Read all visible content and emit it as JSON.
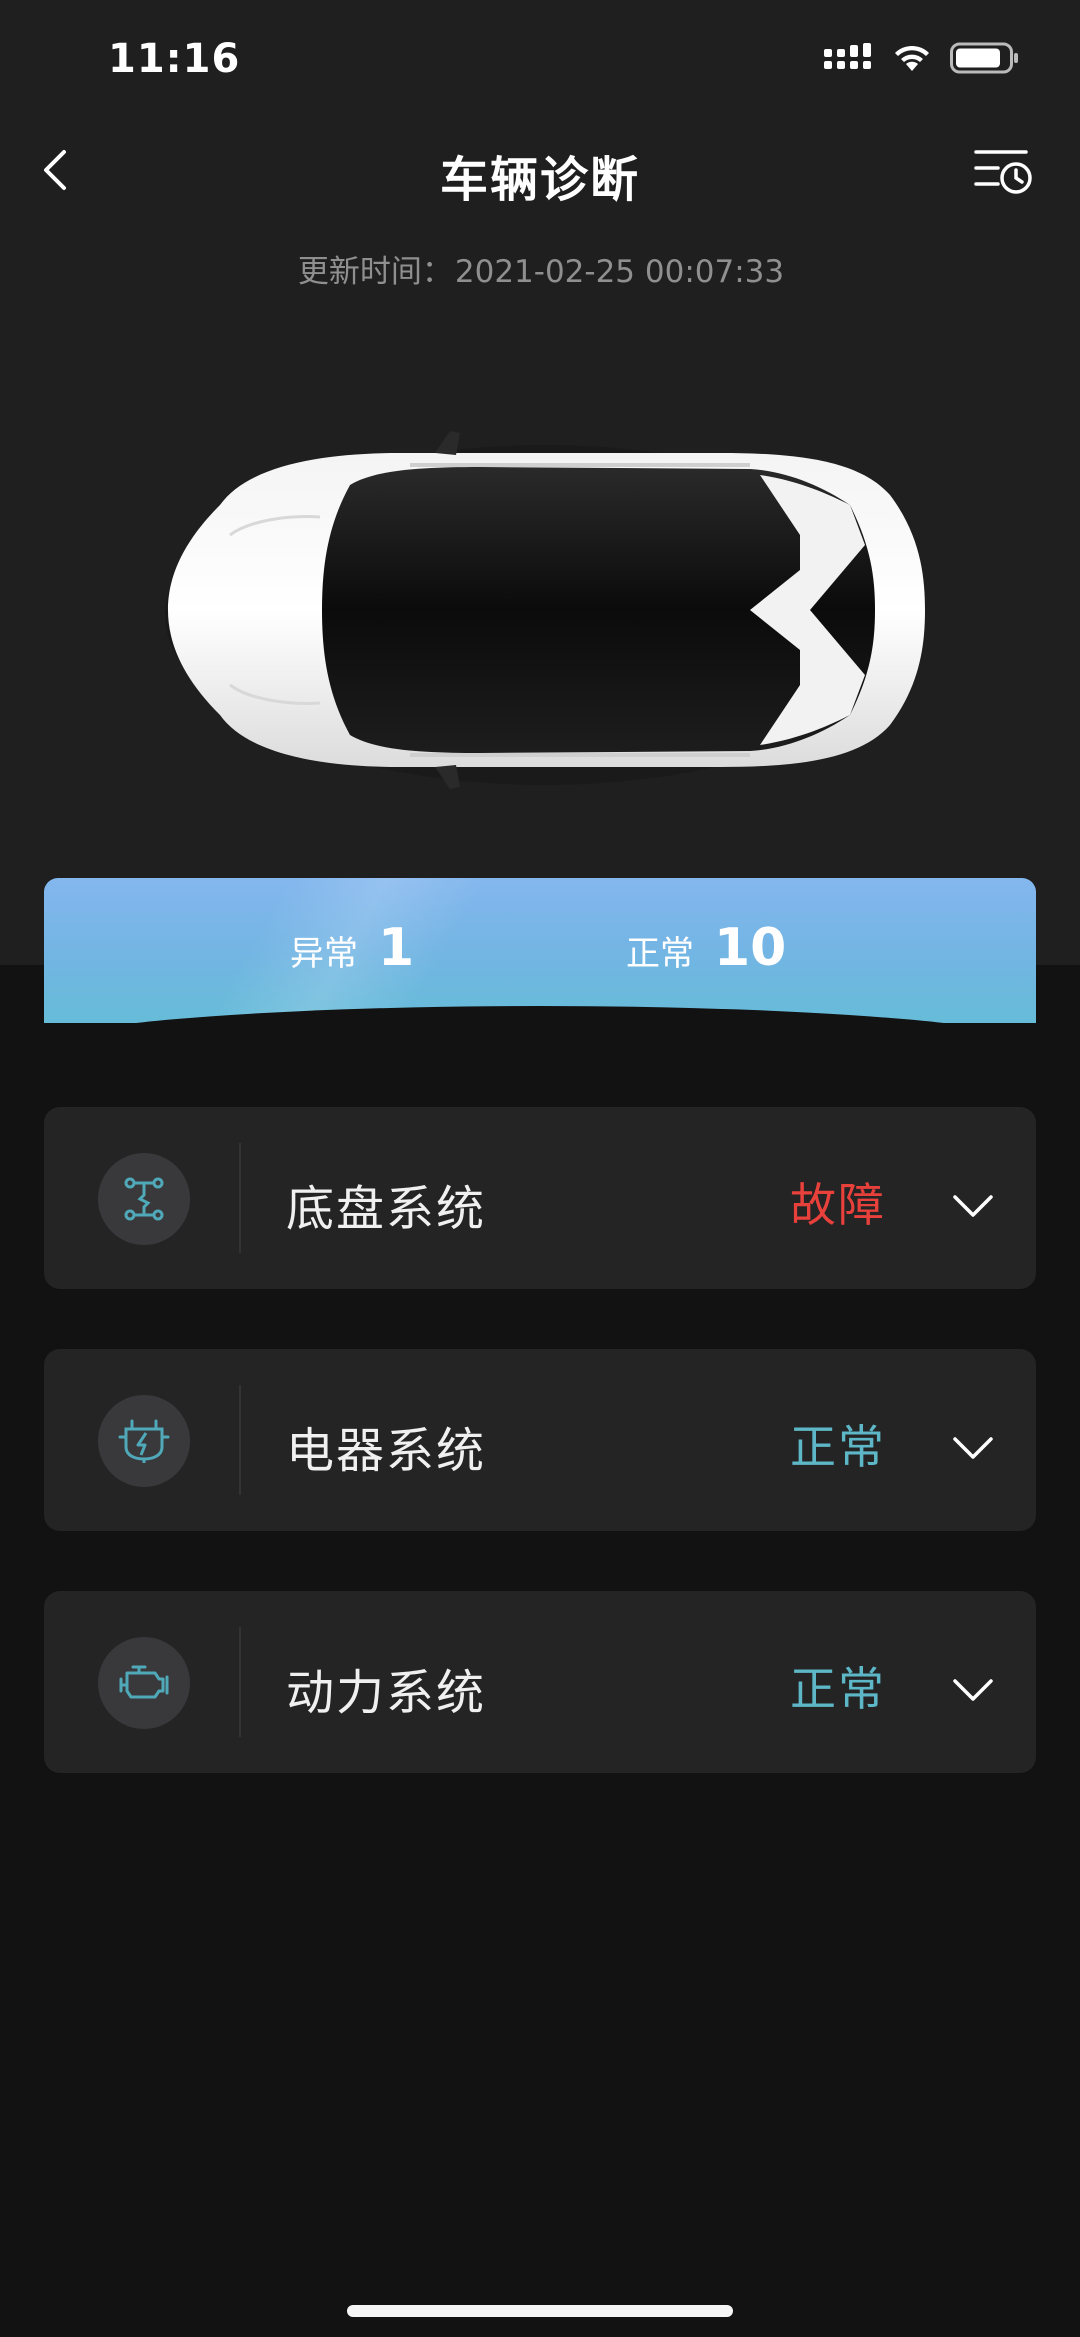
{
  "status_bar": {
    "time": "11:16"
  },
  "nav": {
    "title": "车辆诊断",
    "back_icon": "chevron-left-icon",
    "history_icon": "list-clock-icon"
  },
  "update": {
    "label": "更新时间：",
    "value": "2021-02-25 00:07:33"
  },
  "summary": {
    "abnormal_label": "异常",
    "abnormal_count": "1",
    "normal_label": "正常",
    "normal_count": "10"
  },
  "systems": [
    {
      "name": "底盘系统",
      "status": "故障",
      "icon": "chassis-icon"
    },
    {
      "name": "电器系统",
      "status": "正常",
      "icon": "electrical-icon"
    },
    {
      "name": "动力系统",
      "status": "正常",
      "icon": "engine-icon"
    }
  ],
  "colors": {
    "fault": "#e8403b",
    "normal": "#5db7c7",
    "icon_accent": "#4fa9b8"
  }
}
